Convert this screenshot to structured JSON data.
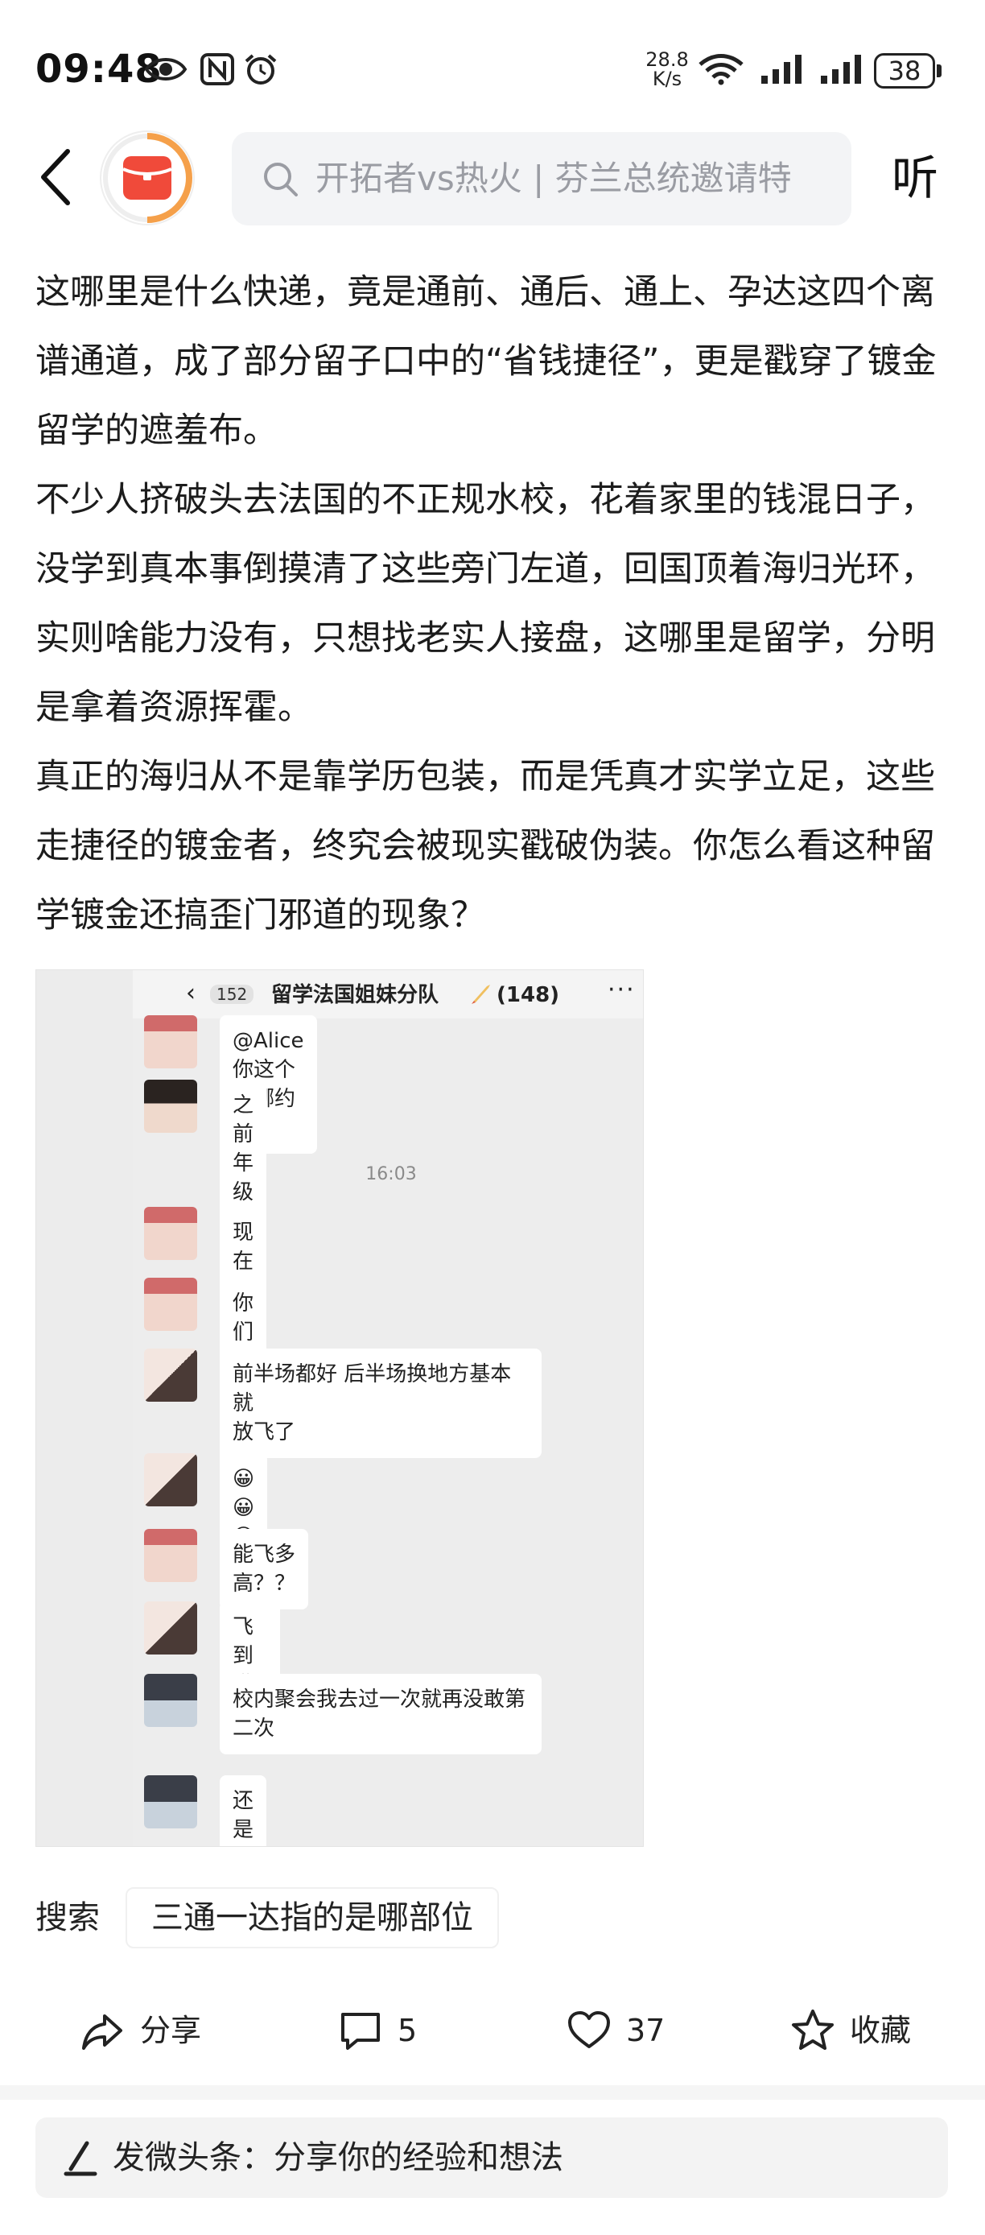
{
  "status_bar": {
    "time": "09:48",
    "net_speed_value": "28.8",
    "net_speed_unit": "K/s",
    "battery": "38"
  },
  "header": {
    "search_placeholder": "开拓者vs热火 | 芬兰总统邀请特",
    "listen_label": "听"
  },
  "article": {
    "paragraphs": [
      "这哪里是什么快递，竟是通前、通后、通上、孕达这四个离谱通道，成了部分留子口中的“省钱捷径”，更是戳穿了镀金留学的遮羞布。",
      "不少人挤破头去法国的不正规水校，花着家里的钱混日子，没学到真本事倒摸清了这些旁门左道，回国顶着海归光环，实则啥能力没有，只想找老实人接盘，这哪里是留学，分明是拿着资源挥霍。",
      "真正的海归从不是靠学历包装，而是凭真才实学立足，这些走捷径的镀金者，终究会被现实戳破伪装。你怎么看这种留学镀金还搞歪门邪道的现象？"
    ]
  },
  "chat": {
    "back_count": "152",
    "title": "留学法国姐妹分队",
    "members": "(148)",
    "timestamp": "16:03",
    "messages": [
      {
        "text": "@Alice 你这个在哪约的?"
      },
      {
        "text": "之前年级聚会认识的"
      },
      {
        "text": "现在班里聚会我都不敢去"
      },
      {
        "text": "你们学校聚会乱吗"
      },
      {
        "text": "前半场都好 后半场换地方基本就\n放飞了"
      },
      {
        "text": "😀😀😀"
      },
      {
        "text": "能飞多高？？"
      },
      {
        "text": "飞到满载.."
      },
      {
        "text": "校内聚会我去过一次就再没敢第\n二次"
      },
      {
        "text": "还是让他们本地人自己飞吧"
      }
    ]
  },
  "search_suggestion": {
    "label": "搜索",
    "query": "三通一达指的是哪部位"
  },
  "actions": {
    "share": "分享",
    "comments": "5",
    "likes": "37",
    "favorite": "收藏"
  },
  "comment_bar": {
    "placeholder": "发微头条：分享你的经验和想法"
  },
  "colors": {
    "logo_red": "#f04a3a",
    "logo_orange": "#f5a04a",
    "search_bg": "#f3f4f6",
    "placeholder_gray": "#9a9ca3"
  }
}
